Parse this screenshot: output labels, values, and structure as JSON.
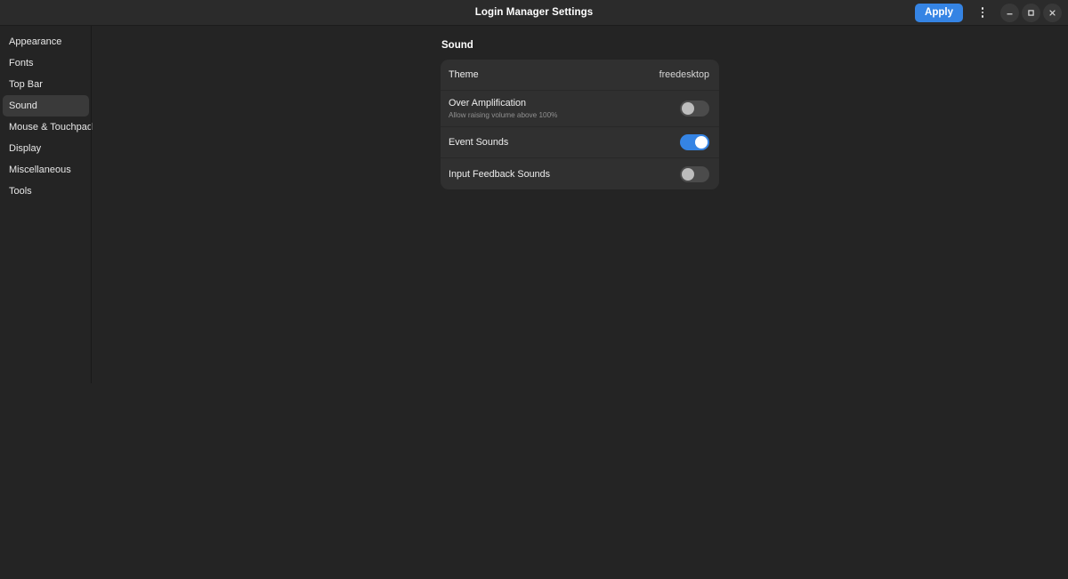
{
  "window": {
    "title": "Login Manager Settings",
    "apply_label": "Apply",
    "menu_icon": "menu-dots-vertical-icon",
    "minimize_icon": "minimize-icon",
    "maximize_icon": "maximize-icon",
    "close_icon": "close-icon",
    "accent_color": "#3584e4"
  },
  "sidebar": {
    "items": [
      {
        "label": "Appearance",
        "selected": false
      },
      {
        "label": "Fonts",
        "selected": false
      },
      {
        "label": "Top Bar",
        "selected": false
      },
      {
        "label": "Sound",
        "selected": true
      },
      {
        "label": "Mouse & Touchpad",
        "selected": false
      },
      {
        "label": "Display",
        "selected": false
      },
      {
        "label": "Miscellaneous",
        "selected": false
      },
      {
        "label": "Tools",
        "selected": false
      }
    ]
  },
  "main": {
    "section_title": "Sound",
    "rows": [
      {
        "title": "Theme",
        "subtitle": "",
        "control": "value",
        "value": "freedesktop"
      },
      {
        "title": "Over Amplification",
        "subtitle": "Allow raising volume above 100%",
        "control": "toggle",
        "toggle_on": false
      },
      {
        "title": "Event Sounds",
        "subtitle": "",
        "control": "toggle",
        "toggle_on": true
      },
      {
        "title": "Input Feedback Sounds",
        "subtitle": "",
        "control": "toggle",
        "toggle_on": false
      }
    ]
  }
}
